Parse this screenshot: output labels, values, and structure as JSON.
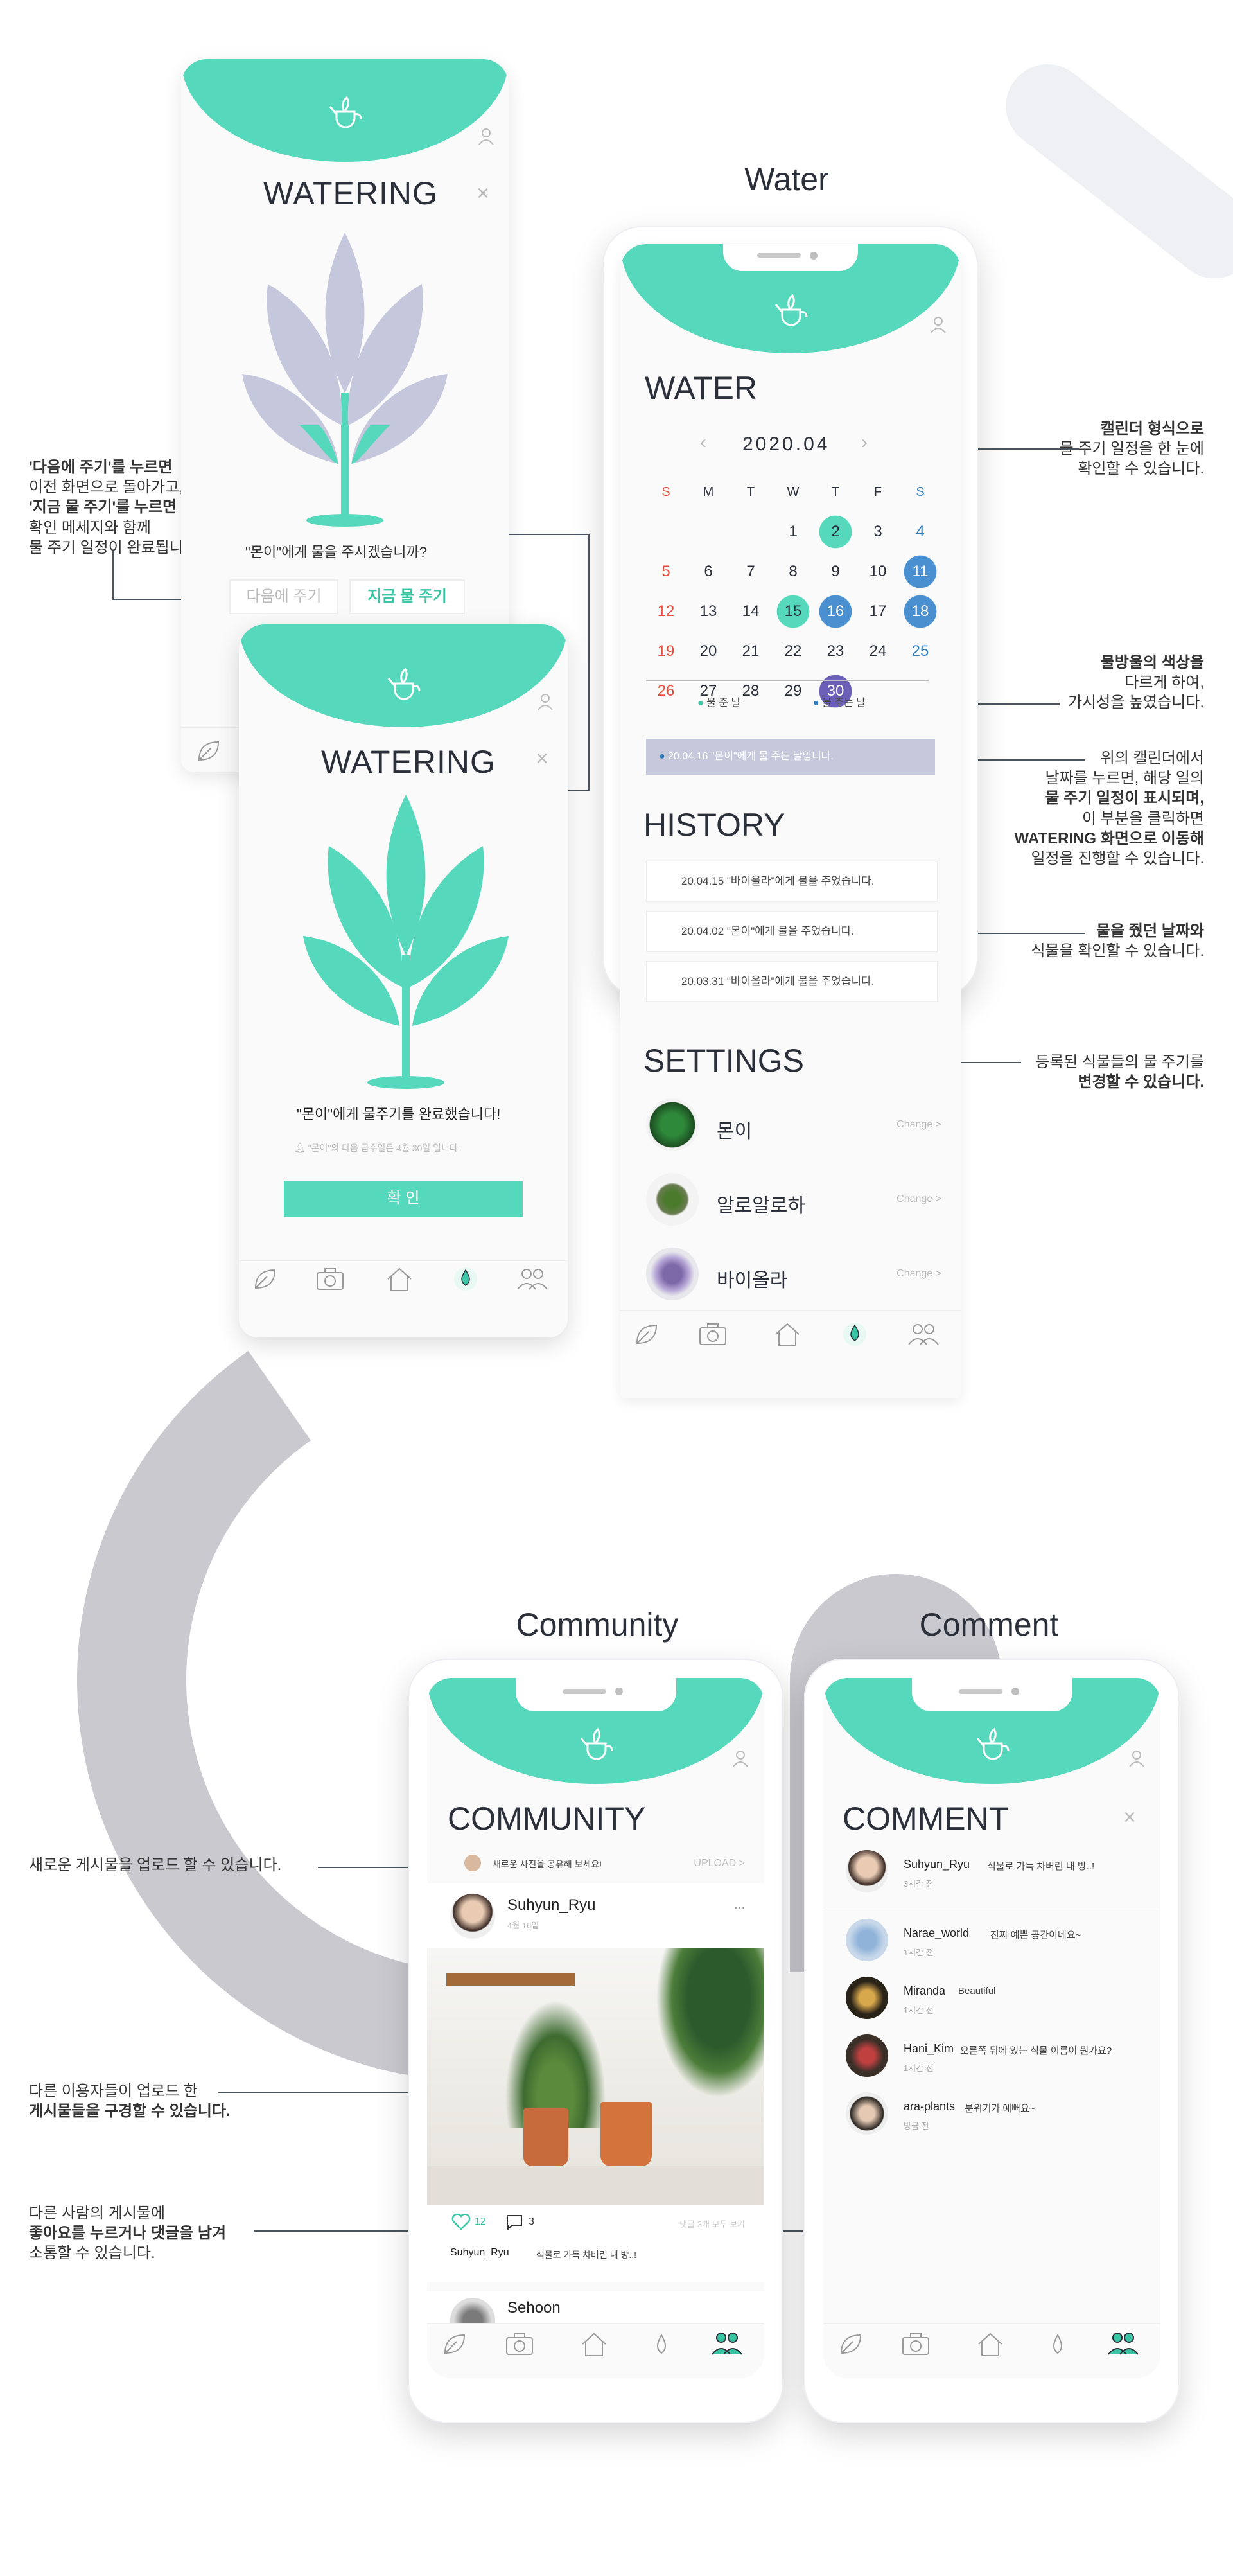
{
  "colors": {
    "accent": "#56d8bc",
    "dark": "#2a2f3a",
    "plant_grey": "#c5c8dc",
    "highlight": "#c5c9db",
    "sunday": "#e74c3c",
    "saturday": "#2f7fbf"
  },
  "page_titles": {
    "water": "Water",
    "community": "Community",
    "comment": "Comment"
  },
  "screen1": {
    "title": "WATERING",
    "question": "\"몬이\"에게 물을 주시겠습니까?",
    "later_button": "다음에 주기",
    "now_button": "지금 물 주기"
  },
  "screen2": {
    "title": "WATERING",
    "done_text": "\"몬이\"에게 물주기를 완료했습니다!",
    "next_info": "\"몬이\"의 다음 급수일은 4월 30일 입니다.",
    "confirm_button": "확 인"
  },
  "water": {
    "title": "WATER",
    "month": "2020.04",
    "weekdays": [
      "S",
      "M",
      "T",
      "W",
      "T",
      "F",
      "S"
    ],
    "weeks": [
      [
        "",
        "",
        "",
        "1",
        "2",
        "3",
        "4"
      ],
      [
        "5",
        "6",
        "7",
        "8",
        "9",
        "10",
        "11"
      ],
      [
        "12",
        "13",
        "14",
        "15",
        "16",
        "17",
        "18"
      ],
      [
        "19",
        "20",
        "21",
        "22",
        "23",
        "24",
        "25"
      ],
      [
        "26",
        "27",
        "28",
        "29",
        "30",
        "",
        ""
      ]
    ],
    "legend_watered": "물 준 날",
    "legend_to_water": "물 주는 날",
    "highlight_text": "20.04.16  \"몬이\"에게 물 주는 날입니다.",
    "history_title": "HISTORY",
    "history": [
      "20.04.15  \"바이올라\"에게 물을 주었습니다.",
      "20.04.02  \"몬이\"에게 물을 주었습니다.",
      "20.03.31  \"바이올라\"에게 물을 주었습니다."
    ],
    "settings_title": "SETTINGS",
    "plants": [
      {
        "name": "몬이",
        "change": "Change >"
      },
      {
        "name": "알로알로하",
        "change": "Change >"
      },
      {
        "name": "바이올라",
        "change": "Change >"
      }
    ]
  },
  "annotations": {
    "later_l1": "'다음에 주기'를 누르면",
    "later_l2": "이전 화면으로 돌아가고,",
    "later_l3": "'지금 물 주기'를 누르면",
    "later_l4": "확인 메세지와 함께",
    "later_l5": "물 주기 일정이 완료됩니다.",
    "cal_l1": "캘린더 형식으로",
    "cal_l2": "물 주기 일정을 한 눈에",
    "cal_l3": "확인할 수 있습니다.",
    "drop_l1": "물방울의 색상을",
    "drop_l2": "다르게 하여,",
    "drop_l3": "가시성을 높였습니다.",
    "day_l1": "위의 캘린더에서",
    "day_l2": "날짜를 누르면, 해당 일의",
    "day_l3": "물 주기 일정이 표시되며,",
    "day_l4": "이 부분을 클릭하면",
    "day_l5": "WATERING 화면으로 이동해",
    "day_l6": "일정을 진행할 수 있습니다.",
    "hist_l1": "물을 줬던 날짜와",
    "hist_l2": "식물을 확인할 수 있습니다.",
    "set_l1": "등록된 식물들의 물 주기를",
    "set_l2": "변경할 수 있습니다.",
    "upload": "새로운 게시물을 업로드 할 수 있습니다.",
    "browse_l1": "다른 이용자들이 업로드 한",
    "browse_l2": "게시물들을 구경할 수 있습니다.",
    "like_l1": "다른 사람의 게시물에",
    "like_l2": "좋아요를 누르거나 댓글을 남겨",
    "like_l3": "소통할 수 있습니다."
  },
  "community": {
    "title": "COMMUNITY",
    "share_prompt": "새로운 사진을 공유해 보세요!",
    "upload": "UPLOAD >",
    "post_user": "Suhyun_Ryu",
    "post_date": "4월 16일",
    "more": "...",
    "likes": "12",
    "comments": "3",
    "view_comments": "댓글 3개 모두 보기",
    "caption_user": "Suhyun_Ryu",
    "caption": "식물로 가득 차버린 내 방..!",
    "next_user": "Sehoon"
  },
  "comment": {
    "title": "COMMENT",
    "author": {
      "user": "Suhyun_Ryu",
      "text": "식물로 가득 차버린 내 방..!",
      "time": "3시간 전"
    },
    "items": [
      {
        "user": "Narae_world",
        "text": "진짜 예쁜 공간이네요~",
        "time": "1시간 전"
      },
      {
        "user": "Miranda",
        "text": "Beautiful",
        "time": "1시간 전"
      },
      {
        "user": "Hani_Kim",
        "text": "오른쪽 뒤에 있는 식물 이름이 뭔가요?",
        "time": "1시간 전"
      },
      {
        "user": "ara-plants",
        "text": "분위기가 예뻐요~",
        "time": "방금 전"
      }
    ]
  }
}
